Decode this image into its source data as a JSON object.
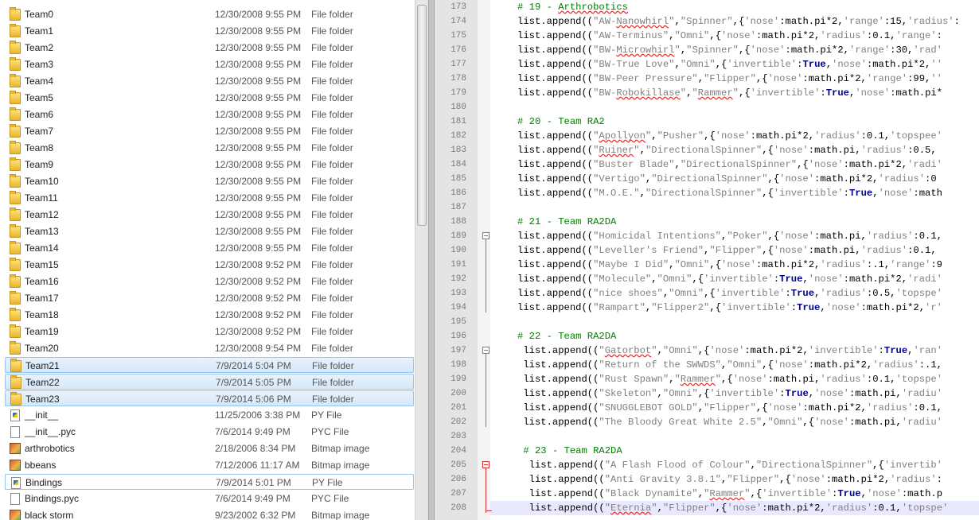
{
  "explorer": {
    "rows": [
      {
        "name": "Team0",
        "date": "12/30/2008 9:55 PM",
        "type": "File folder",
        "icon": "folder-icon"
      },
      {
        "name": "Team1",
        "date": "12/30/2008 9:55 PM",
        "type": "File folder",
        "icon": "folder-icon"
      },
      {
        "name": "Team2",
        "date": "12/30/2008 9:55 PM",
        "type": "File folder",
        "icon": "folder-icon"
      },
      {
        "name": "Team3",
        "date": "12/30/2008 9:55 PM",
        "type": "File folder",
        "icon": "folder-icon"
      },
      {
        "name": "Team4",
        "date": "12/30/2008 9:55 PM",
        "type": "File folder",
        "icon": "folder-icon"
      },
      {
        "name": "Team5",
        "date": "12/30/2008 9:55 PM",
        "type": "File folder",
        "icon": "folder-icon"
      },
      {
        "name": "Team6",
        "date": "12/30/2008 9:55 PM",
        "type": "File folder",
        "icon": "folder-icon"
      },
      {
        "name": "Team7",
        "date": "12/30/2008 9:55 PM",
        "type": "File folder",
        "icon": "folder-icon"
      },
      {
        "name": "Team8",
        "date": "12/30/2008 9:55 PM",
        "type": "File folder",
        "icon": "folder-icon"
      },
      {
        "name": "Team9",
        "date": "12/30/2008 9:55 PM",
        "type": "File folder",
        "icon": "folder-icon"
      },
      {
        "name": "Team10",
        "date": "12/30/2008 9:55 PM",
        "type": "File folder",
        "icon": "folder-icon"
      },
      {
        "name": "Team11",
        "date": "12/30/2008 9:55 PM",
        "type": "File folder",
        "icon": "folder-icon"
      },
      {
        "name": "Team12",
        "date": "12/30/2008 9:55 PM",
        "type": "File folder",
        "icon": "folder-icon"
      },
      {
        "name": "Team13",
        "date": "12/30/2008 9:55 PM",
        "type": "File folder",
        "icon": "folder-icon"
      },
      {
        "name": "Team14",
        "date": "12/30/2008 9:55 PM",
        "type": "File folder",
        "icon": "folder-icon"
      },
      {
        "name": "Team15",
        "date": "12/30/2008 9:52 PM",
        "type": "File folder",
        "icon": "folder-icon"
      },
      {
        "name": "Team16",
        "date": "12/30/2008 9:52 PM",
        "type": "File folder",
        "icon": "folder-icon"
      },
      {
        "name": "Team17",
        "date": "12/30/2008 9:52 PM",
        "type": "File folder",
        "icon": "folder-icon"
      },
      {
        "name": "Team18",
        "date": "12/30/2008 9:52 PM",
        "type": "File folder",
        "icon": "folder-icon"
      },
      {
        "name": "Team19",
        "date": "12/30/2008 9:52 PM",
        "type": "File folder",
        "icon": "folder-icon"
      },
      {
        "name": "Team20",
        "date": "12/30/2008 9:54 PM",
        "type": "File folder",
        "icon": "folder-icon"
      },
      {
        "name": "Team21",
        "date": "7/9/2014 5:04 PM",
        "type": "File folder",
        "icon": "folder-icon",
        "selected": true
      },
      {
        "name": "Team22",
        "date": "7/9/2014 5:05 PM",
        "type": "File folder",
        "icon": "folder-icon",
        "selected": true
      },
      {
        "name": "Team23",
        "date": "7/9/2014 5:06 PM",
        "type": "File folder",
        "icon": "folder-icon",
        "selected": true
      },
      {
        "name": "__init__",
        "date": "11/25/2006 3:38 PM",
        "type": "PY File",
        "icon": "python-file-icon"
      },
      {
        "name": "__init__.pyc",
        "date": "7/6/2014 9:49 PM",
        "type": "PYC File",
        "icon": "document-icon"
      },
      {
        "name": "arthrobotics",
        "date": "2/18/2006 8:34 PM",
        "type": "Bitmap image",
        "icon": "bitmap-icon"
      },
      {
        "name": "bbeans",
        "date": "7/12/2006 11:17 AM",
        "type": "Bitmap image",
        "icon": "bitmap-icon"
      },
      {
        "name": "Bindings",
        "date": "7/9/2014 5:01 PM",
        "type": "PY File",
        "icon": "python-file-icon",
        "focused": true
      },
      {
        "name": "Bindings.pyc",
        "date": "7/6/2014 9:49 PM",
        "type": "PYC File",
        "icon": "document-icon"
      },
      {
        "name": "black storm",
        "date": "9/23/2002 6:32 PM",
        "type": "Bitmap image",
        "icon": "bitmap-icon"
      }
    ]
  },
  "editor": {
    "highlight_line": "208",
    "lines": [
      {
        "n": "173",
        "code": "# 19 - Arthrobotics",
        "kind": "comment"
      },
      {
        "n": "174",
        "code": "list.append((\"AW-Nanowhirl\",\"Spinner\",{'nose':math.pi*2,'range':15,'radius':"
      },
      {
        "n": "175",
        "code": "list.append((\"AW-Terminus\",\"Omni\",{'nose':math.pi*2,'radius':0.1,'range':"
      },
      {
        "n": "176",
        "code": "list.append((\"BW-Microwhirl\",\"Spinner\",{'nose':math.pi*2,'range':30,'radi"
      },
      {
        "n": "177",
        "code": "list.append((\"BW-True Love\",\"Omni\",{'invertible':True,'nose':math.pi*2,'r"
      },
      {
        "n": "178",
        "code": "list.append((\"BW-Peer Pressure\",\"Flipper\",{'nose':math.pi*2,'range':99,'r"
      },
      {
        "n": "179",
        "code": "list.append((\"BW-Robokillase\",\"Rammer\",{'invertible':True,'nose':math.pi*"
      },
      {
        "n": "180",
        "code": ""
      },
      {
        "n": "181",
        "code": "# 20 - Team RA2",
        "kind": "comment"
      },
      {
        "n": "182",
        "code": "list.append((\"Apollyon\",\"Pusher\",{'nose':math.pi*2,'radius':0.1,'topspeed"
      },
      {
        "n": "183",
        "code": "list.append((\"Ruiner\",\"DirectionalSpinner\",{'nose':math.pi,'radius':0.5,"
      },
      {
        "n": "184",
        "code": "list.append((\"Buster Blade\",\"DirectionalSpinner\",{'nose':math.pi*2,'radiu"
      },
      {
        "n": "185",
        "code": "list.append((\"Vertigo\",\"DirectionalSpinner\",{'nose':math.pi*2,'radius':0"
      },
      {
        "n": "186",
        "code": "list.append((\"M.O.E.\",\"DirectionalSpinner\",{'invertible':True,'nose':math"
      },
      {
        "n": "187",
        "code": ""
      },
      {
        "n": "188",
        "code": "# 21 - Team RA2DA",
        "kind": "comment"
      },
      {
        "n": "189",
        "code": "list.append((\"Homicidal Intentions\",\"Poker\",{'nose':math.pi,'radius':0.1,"
      },
      {
        "n": "190",
        "code": "list.append((\"Leveller's Friend\",\"Flipper\",{'nose':math.pi,'radius':0.1,"
      },
      {
        "n": "191",
        "code": "list.append((\"Maybe I Did\",\"Omni\",{'nose':math.pi*2,'radius':.1,'range':9"
      },
      {
        "n": "192",
        "code": "list.append((\"Molecule\",\"Omni\",{'invertible':True,'nose':math.pi*2,'radiu"
      },
      {
        "n": "193",
        "code": "list.append((\"nice shoes\",\"Omni\",{'invertible':True,'radius':0.5,'topspee"
      },
      {
        "n": "194",
        "code": "list.append((\"Rampart\",\"Flipper2\",{'invertible':True,'nose':math.pi*2,'ra"
      },
      {
        "n": "195",
        "code": ""
      },
      {
        "n": "196",
        "code": "# 22 - Team RA2DA",
        "kind": "comment"
      },
      {
        "n": "197",
        "code": " list.append((\"Gatorbot\",\"Omni\",{'nose':math.pi*2,'invertible':True,'rang"
      },
      {
        "n": "198",
        "code": " list.append((\"Return of the SWWDS\",\"Omni\",{'nose':math.pi*2,'radius':.1,"
      },
      {
        "n": "199",
        "code": " list.append((\"Rust Spawn\",\"Rammer\",{'nose':math.pi,'radius':0.1,'topspee"
      },
      {
        "n": "200",
        "code": " list.append((\"Skeleton\",\"Omni\",{'invertible':True,'nose':math.pi,'radius"
      },
      {
        "n": "201",
        "code": " list.append((\"SNUGGLEBOT GOLD\",\"Flipper\",{'nose':math.pi*2,'radius':0.1,"
      },
      {
        "n": "202",
        "code": " list.append((\"The Bloody Great White 2.5\",\"Omni\",{'nose':math.pi,'radius"
      },
      {
        "n": "203",
        "code": ""
      },
      {
        "n": "204",
        "code": " # 23 - Team RA2DA",
        "kind": "comment"
      },
      {
        "n": "205",
        "code": "  list.append((\"A Flash Flood of Colour\",\"DirectionalSpinner\",{'invertibl"
      },
      {
        "n": "206",
        "code": "  list.append((\"Anti Gravity 3.8.1\",\"Flipper\",{'nose':math.pi*2,'radius':"
      },
      {
        "n": "207",
        "code": "  list.append((\"Black Dynamite\",\"Rammer\",{'invertible':True,'nose':math.p"
      },
      {
        "n": "208",
        "code": "  list.append((\"Eternia\",\"Flipper\",{'nose':math.pi*2,'radius':0.1,'topspee"
      }
    ],
    "misspelled": [
      "Arthrobotics",
      "Nanowhirl",
      "Microwhirl",
      "Robokillase",
      "Rammer",
      "Apollyon",
      "Ruiner",
      "Gatorbot",
      "Eternia"
    ]
  },
  "colors": {
    "comment": "#008000",
    "string": "#808080",
    "keyword": "#00008b",
    "selection": "#d6e8fa",
    "current_line": "#e8e8ff",
    "fold_active": "#d03030"
  }
}
